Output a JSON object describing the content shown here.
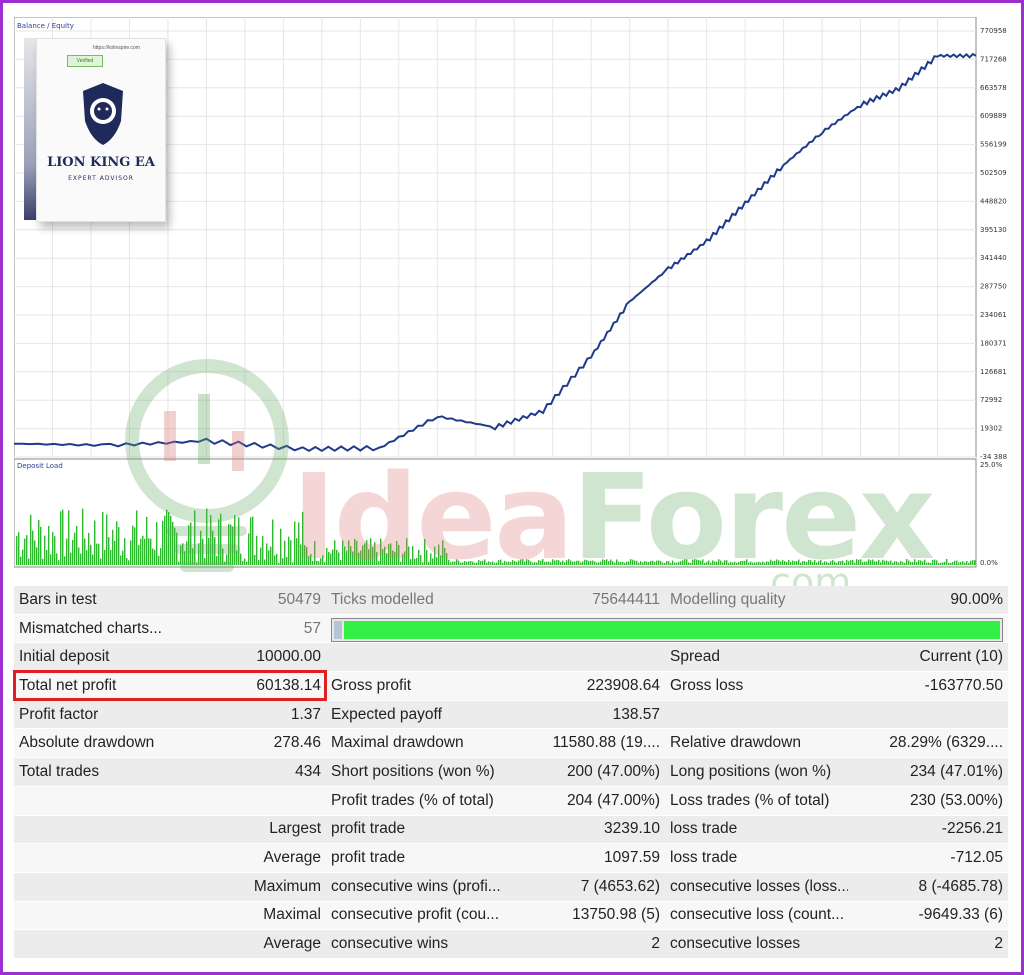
{
  "chart": {
    "top_label": "Balance / Equity",
    "bottom_label": "Deposit Load",
    "y_ticks": [
      "770958",
      "717268",
      "663578",
      "609889",
      "556199",
      "502509",
      "448820",
      "395130",
      "341440",
      "287750",
      "234061",
      "180371",
      "126681",
      "72992",
      "19302",
      "-34 388"
    ],
    "load_ticks": [
      "25.0%",
      "0.0%"
    ],
    "line_color": "#1f3a8a",
    "bar_color": "#2db82d"
  },
  "chart_data": {
    "type": "line",
    "series": [
      {
        "x": [
          0,
          10,
          20,
          30,
          38,
          44,
          50,
          55,
          60,
          64,
          68,
          72,
          76,
          80,
          84,
          88,
          92,
          96,
          100
        ],
        "y": [
          -10000,
          -13000,
          -5000,
          -20000,
          -18000,
          40000,
          20000,
          50000,
          150000,
          250000,
          310000,
          360000,
          430000,
          500000,
          560000,
          610000,
          640000,
          700000,
          700000
        ]
      }
    ],
    "xlabel": "",
    "ylabel": "",
    "ylim": [
      -34388,
      770958
    ]
  },
  "product": {
    "url": "https://kolinspire.com",
    "badge": "Verified",
    "title": "LION KING EA",
    "subtitle": "EXPERT ADVISOR"
  },
  "watermark": {
    "idea": "Idea",
    "forex": "Forex",
    "com": ".com"
  },
  "table": {
    "bars_label": "Bars in test",
    "bars_value": "50479",
    "ticks_label": "Ticks modelled",
    "ticks_value": "75644411",
    "mq_label": "Modelling quality",
    "mq_value": "90.00%",
    "mq_fraction": 0.9,
    "mismatch_label": "Mismatched charts...",
    "mismatch_value": "57",
    "init_label": "Initial deposit",
    "init_value": "10000.00",
    "spread_label": "Spread",
    "spread_value": "Current (10)",
    "tnp_label": "Total net profit",
    "tnp_value": "60138.14",
    "gp_label": "Gross profit",
    "gp_value": "223908.64",
    "gl_label": "Gross loss",
    "gl_value": "-163770.50",
    "pf_label": "Profit factor",
    "pf_value": "1.37",
    "ep_label": "Expected payoff",
    "ep_value": "138.57",
    "ad_label": "Absolute drawdown",
    "ad_value": "278.46",
    "md_label": "Maximal drawdown",
    "md_value": "11580.88 (19....",
    "rd_label": "Relative drawdown",
    "rd_value": "28.29% (6329....",
    "tt_label": "Total trades",
    "tt_value": "434",
    "sp_label": "Short positions (won %)",
    "sp_value": "200 (47.00%)",
    "lp_label": "Long positions (won %)",
    "lp_value": "234 (47.01%)",
    "pt_label": "Profit trades (% of total)",
    "pt_value": "204 (47.00%)",
    "lt_label": "Loss trades (% of total)",
    "lt_value": "230 (53.00%)",
    "largest": "Largest",
    "l_pt": "profit trade",
    "l_pt_v": "3239.10",
    "l_lt": "loss trade",
    "l_lt_v": "-2256.21",
    "average": "Average",
    "a_pt": "profit trade",
    "a_pt_v": "1097.59",
    "a_lt": "loss trade",
    "a_lt_v": "-712.05",
    "maximum": "Maximum",
    "m_cw": "consecutive wins (profi...",
    "m_cw_v": "7 (4653.62)",
    "m_cl": "consecutive losses (loss...",
    "m_cl_v": "8 (-4685.78)",
    "maximal": "Maximal",
    "x_cp": "consecutive profit (cou...",
    "x_cp_v": "13750.98 (5)",
    "x_cl": "consecutive loss (count...",
    "x_cl_v": "-9649.33 (6)",
    "average2": "Average",
    "v_cw": "consecutive wins",
    "v_cw_v": "2",
    "v_cl": "consecutive losses",
    "v_cl_v": "2"
  }
}
